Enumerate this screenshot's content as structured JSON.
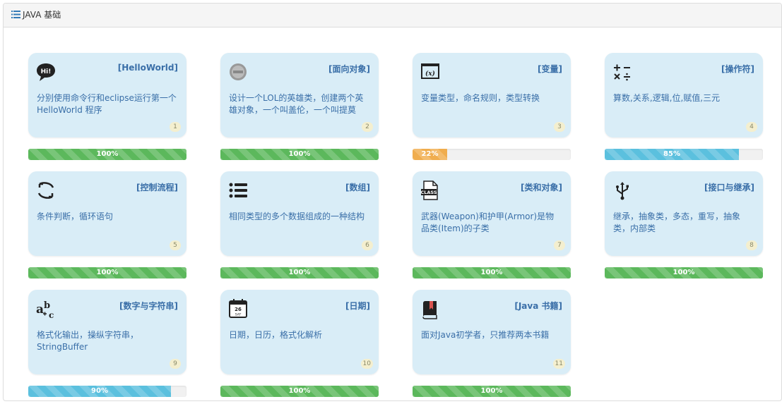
{
  "header": {
    "title": "JAVA 基础",
    "icon": "list-icon"
  },
  "cards": [
    {
      "title": "[HelloWorld]",
      "desc": "分别使用命令行和eclipse运行第一个HelloWorld 程序",
      "num": "1",
      "icon": "speech-bubble-hi-icon",
      "progress": 100,
      "progress_label": "100%",
      "progress_color": "#5cb85c"
    },
    {
      "title": "[面向对象]",
      "desc": "设计一个LOL的英雄类，创建两个英雄对象，一个叫盖伦，一个叫提莫",
      "num": "2",
      "icon": "game-logo-icon",
      "progress": 100,
      "progress_label": "100%",
      "progress_color": "#5cb85c"
    },
    {
      "title": "[变量]",
      "desc": "变量类型，命名规则，类型转换",
      "num": "3",
      "icon": "variable-x-icon",
      "progress": 22,
      "progress_label": "22%",
      "progress_color": "#f0ad4e"
    },
    {
      "title": "[操作符]",
      "desc": "算数,关系,逻辑,位,赋值,三元",
      "num": "4",
      "icon": "operators-icon",
      "progress": 85,
      "progress_label": "85%",
      "progress_color": "#5bc0de"
    },
    {
      "title": "[控制流程]",
      "desc": "条件判断，循环语句",
      "num": "5",
      "icon": "loop-arrows-icon",
      "progress": 100,
      "progress_label": "100%",
      "progress_color": "#5cb85c"
    },
    {
      "title": "[数组]",
      "desc": "相同类型的多个数据组成的一种结构",
      "num": "6",
      "icon": "bullet-list-icon",
      "progress": 100,
      "progress_label": "100%",
      "progress_color": "#5cb85c"
    },
    {
      "title": "[类和对象]",
      "desc": "武器(Weapon)和护甲(Armor)是物品类(Item)的子类",
      "num": "7",
      "icon": "class-file-icon",
      "progress": 100,
      "progress_label": "100%",
      "progress_color": "#5cb85c"
    },
    {
      "title": "[接口与继承]",
      "desc": "继承，抽象类，多态，重写，抽象类，内部类",
      "num": "8",
      "icon": "usb-icon",
      "progress": 100,
      "progress_label": "100%",
      "progress_color": "#5cb85c"
    },
    {
      "title": "[数字与字符串]",
      "desc": "格式化输出，操纵字符串，StringBuffer",
      "num": "9",
      "icon": "spellcheck-abc-icon",
      "progress": 90,
      "progress_label": "90%",
      "progress_color": "#5bc0de"
    },
    {
      "title": "[日期]",
      "desc": "日期，日历，格式化解析",
      "num": "10",
      "icon": "calendar-icon",
      "progress": 100,
      "progress_label": "100%",
      "progress_color": "#5cb85c"
    },
    {
      "title": "[Java 书籍]",
      "desc": "面对Java初学者，只推荐两本书籍",
      "num": "11",
      "icon": "book-icon",
      "progress": 100,
      "progress_label": "100%",
      "progress_color": "#5cb85c"
    }
  ],
  "calendar_icon_text": {
    "day": "26",
    "label": "SAT"
  },
  "class_icon_text": "CLASS",
  "hi_icon_text": "Hi!"
}
